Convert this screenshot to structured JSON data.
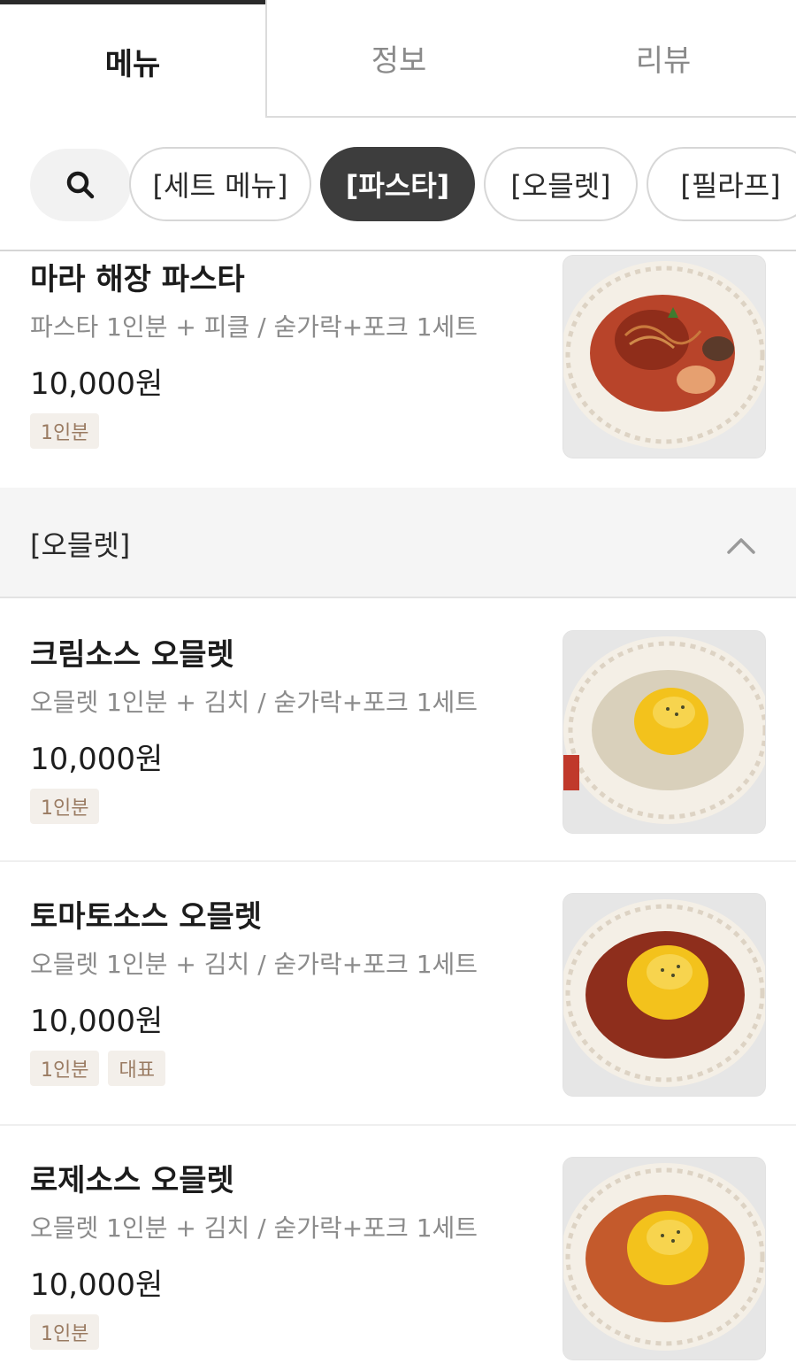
{
  "tabs": [
    {
      "label": "메뉴",
      "active": true
    },
    {
      "label": "정보",
      "active": false
    },
    {
      "label": "리뷰",
      "active": false
    }
  ],
  "icons": {
    "search": "search-icon",
    "collapse": "chevron-up-icon"
  },
  "chips": [
    {
      "label": "[세트 메뉴]",
      "active": false
    },
    {
      "label": "[파스타]",
      "active": true
    },
    {
      "label": "[오믈렛]",
      "active": false
    },
    {
      "label": "[필라프]",
      "active": false
    }
  ],
  "items": [
    {
      "name": "마라 해장 파스타",
      "desc": "파스타 1인분 + 피클 / 숟가락+포크 1세트",
      "price": "10,000원",
      "badges": [
        "1인분"
      ],
      "image": "pasta-plate"
    }
  ],
  "section": {
    "title": "[오믈렛]",
    "expanded": true
  },
  "omelet_items": [
    {
      "name": "크림소스 오믈렛",
      "desc": "오믈렛 1인분 + 김치 / 숟가락+포크 1세트",
      "price": "10,000원",
      "badges": [
        "1인분"
      ],
      "image": "cream-omelet-plate"
    },
    {
      "name": "토마토소스 오믈렛",
      "desc": "오믈렛 1인분 + 김치 / 숟가락+포크 1세트",
      "price": "10,000원",
      "badges": [
        "1인분",
        "대표"
      ],
      "image": "tomato-omelet-plate"
    },
    {
      "name": "로제소스 오믈렛",
      "desc": "오믈렛 1인분 + 김치 / 숟가락+포크 1세트",
      "price": "10,000원",
      "badges": [
        "1인분"
      ],
      "image": "rose-omelet-plate"
    }
  ],
  "colors": {
    "active_chip_bg": "#3d3d3d",
    "badge_bg": "#f3efea",
    "badge_text": "#9a7b62",
    "section_bg": "#f5f5f5"
  }
}
